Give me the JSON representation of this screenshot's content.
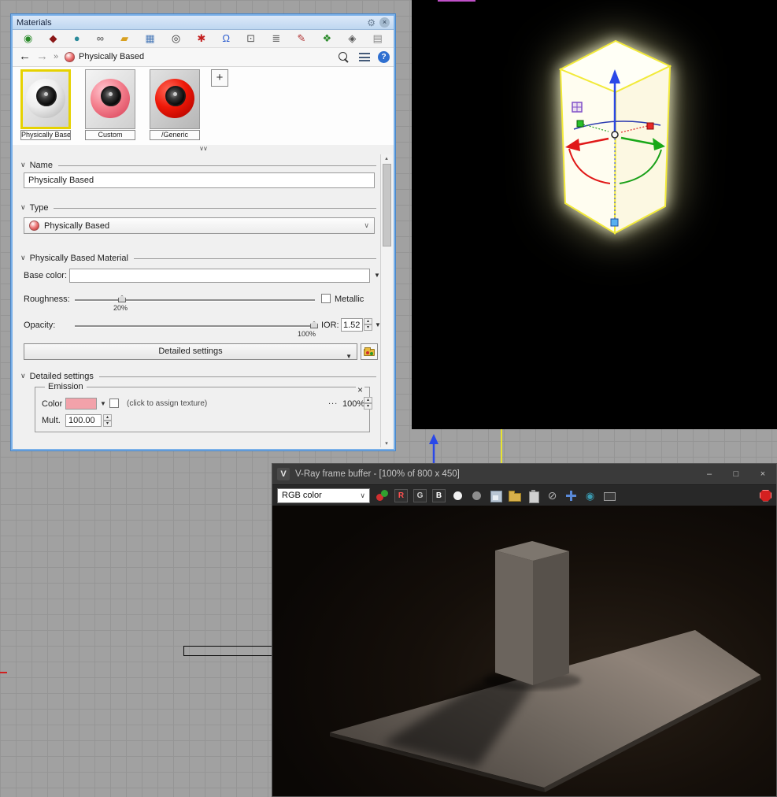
{
  "glyphs": {
    "chevron_down": "∨",
    "dropdown_arrow": "▼",
    "select_arrow": "∨",
    "spin_up": "▴",
    "spin_down": "▾",
    "back_arrow": "←",
    "forward_arrow": "→",
    "breadcrumb_sep": "»",
    "plus": "+",
    "gear": "⚙",
    "panel_close": "×",
    "collapse": "∨∨",
    "help": "?",
    "scroll_up": "▴",
    "scroll_down": "▾",
    "emission_close": "×",
    "ellipsis": "...",
    "minimize": "–",
    "maximize": "□",
    "close": "×"
  },
  "materials_panel": {
    "title": "Materials",
    "toolbar_icons": [
      {
        "name": "sphere-icon",
        "glyph": "◉"
      },
      {
        "name": "material-icon",
        "glyph": "◆"
      },
      {
        "name": "ball-icon",
        "glyph": "●"
      },
      {
        "name": "link-icon",
        "glyph": "∞"
      },
      {
        "name": "folder-icon",
        "glyph": "▰"
      },
      {
        "name": "image-icon",
        "glyph": "▦"
      },
      {
        "name": "camera-icon",
        "glyph": "◎"
      },
      {
        "name": "snowflake-icon",
        "glyph": "✱"
      },
      {
        "name": "bell-icon",
        "glyph": "Ω"
      },
      {
        "name": "monitor-icon",
        "glyph": "⊡"
      },
      {
        "name": "layers-icon",
        "glyph": "≣"
      },
      {
        "name": "pencil-icon",
        "glyph": "✎"
      },
      {
        "name": "plant-icon",
        "glyph": "❖"
      },
      {
        "name": "diamond-icon",
        "glyph": "◈"
      },
      {
        "name": "document-icon",
        "glyph": "▤"
      }
    ],
    "breadcrumb": "Physically Based",
    "thumbnails": [
      {
        "label": "Physically Based"
      },
      {
        "label": "Custom"
      },
      {
        "label": "/Generic"
      }
    ],
    "name_section": {
      "label": "Name",
      "value": "Physically Based"
    },
    "type_section": {
      "label": "Type",
      "value": "Physically Based"
    },
    "pbm_section": {
      "label": "Physically Based Material",
      "base_color_label": "Base color:",
      "roughness_label": "Roughness:",
      "roughness_value": "20%",
      "metallic_label": "Metallic",
      "opacity_label": "Opacity:",
      "opacity_value": "100%",
      "ior_label": "IOR:",
      "ior_value": "1.52",
      "detailed_button_label": "Detailed settings"
    },
    "detailed_section": {
      "label": "Detailed settings",
      "emission": {
        "legend": "Emission",
        "color_label": "Color",
        "texture_hint": "(click to assign texture)",
        "amount": "100%",
        "mult_label": "Mult.",
        "mult_value": "100.00"
      }
    }
  },
  "vray": {
    "logo": "V",
    "title": "V-Ray frame buffer - [100% of 800 x 450]",
    "channel_select": "RGB color",
    "r": "R",
    "g": "G",
    "b": "B"
  },
  "colors": {
    "panel_accent_blue": "#7ab0e8",
    "selection_yellow": "#e6d200",
    "emission_pink": "#f2a2aa",
    "vray_stop_red": "#d42020",
    "glow_yellow": "#f2ea3a"
  }
}
